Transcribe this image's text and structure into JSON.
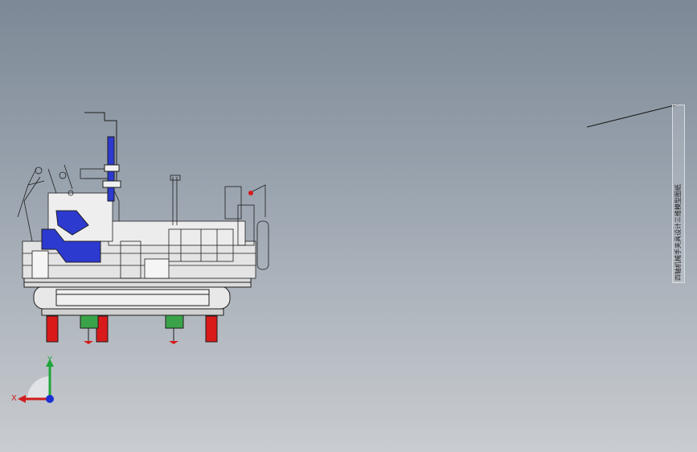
{
  "viewport": {
    "background_top": "#7d8896",
    "background_bottom": "#c9ccd0"
  },
  "model": {
    "name": "fixture-assembly",
    "colors": {
      "linework": "#1e1e1e",
      "blue_part": "#2d3ad0",
      "red_wheel": "#d81a1a",
      "green_caster": "#3aa34a",
      "frame_fill": "#e8e8e8"
    }
  },
  "annotation": {
    "text": "四轴机械手夹具设计三维模型图纸"
  },
  "triad": {
    "x_label": "X",
    "y_label": "Y",
    "x_color": "#d11c1c",
    "y_color": "#1fa53a",
    "z_color": "#1c2fd1"
  }
}
